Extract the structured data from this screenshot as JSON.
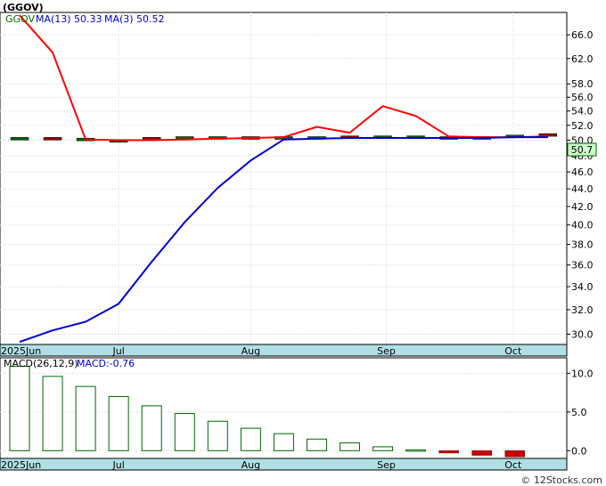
{
  "title": "(GGOV)",
  "watermark": "© 12Stocks.com",
  "price_panel": {
    "legend": {
      "ticker": "GGOV",
      "ma13_label": "MA(13)",
      "ma13_value": "50.33",
      "ma3_label": "MA(3)",
      "ma3_value": "50.52"
    },
    "last_price_label": "50.7",
    "y_ticks": [
      "30.0",
      "32.0",
      "34.0",
      "36.0",
      "38.0",
      "40.0",
      "42.0",
      "44.0",
      "46.0",
      "48.0",
      "50.0",
      "52.0",
      "54.0",
      "56.0",
      "58.0",
      "62.0",
      "66.0"
    ]
  },
  "macd_panel": {
    "legend": {
      "label": "MACD(26,12,9)",
      "value_label": "MACD:-0.76"
    },
    "y_ticks": [
      "0.0",
      "5.0",
      "10.0"
    ]
  },
  "x_ticks": [
    "2025Jun",
    "Jul",
    "Aug",
    "Sep",
    "Oct"
  ],
  "colors": {
    "ma13": "#0000cc",
    "ma3": "#ff0000",
    "macd_pos": "#006600",
    "macd_neg": "#cc0000",
    "candle_up": "#006600",
    "candle_down": "#990000",
    "label_bg": "#ccffcc",
    "axis_strip": "#b0e0e6"
  },
  "chart_data": [
    {
      "type": "line",
      "title": "(GGOV)",
      "x": [
        "2025Jun",
        "",
        "",
        "Jul",
        "",
        "",
        "",
        "Aug",
        "",
        "",
        "",
        "Sep",
        "",
        "",
        "",
        "Oct",
        ""
      ],
      "ylim": [
        29.2,
        70
      ],
      "y_scale": "log",
      "series": [
        {
          "name": "MA(13)",
          "color": "#0000cc",
          "values": [
            29.4,
            30.3,
            31.0,
            32.5,
            36.3,
            40.3,
            44.1,
            47.4,
            50.1,
            50.2,
            50.3,
            50.3,
            50.3,
            50.3,
            50.3,
            50.4,
            50.4
          ]
        },
        {
          "name": "MA(3)",
          "color": "#ff0000",
          "values": [
            69.5,
            63.0,
            50.1,
            50.0,
            50.0,
            50.1,
            50.2,
            50.3,
            50.4,
            51.8,
            51.0,
            54.7,
            53.3,
            50.5,
            50.4,
            50.4,
            50.5
          ]
        },
        {
          "name": "GGOV",
          "color": "#006600",
          "values": [
            50.2,
            50.2,
            50.1,
            49.9,
            50.2,
            50.3,
            50.3,
            50.3,
            50.3,
            50.3,
            50.4,
            50.4,
            50.4,
            50.3,
            50.3,
            50.5,
            50.7
          ]
        }
      ]
    },
    {
      "type": "bar",
      "title": "MACD(26,12,9)",
      "categories": [
        "2025Jun",
        "",
        "",
        "Jul",
        "",
        "",
        "",
        "Aug",
        "",
        "",
        "",
        "Sep",
        "",
        "",
        "",
        "Oct"
      ],
      "values": [
        10.9,
        9.6,
        8.3,
        7.0,
        5.8,
        4.8,
        3.8,
        2.9,
        2.2,
        1.5,
        1.0,
        0.5,
        0.1,
        -0.3,
        -0.6,
        -0.8
      ],
      "ylim": [
        -1,
        12
      ]
    }
  ]
}
